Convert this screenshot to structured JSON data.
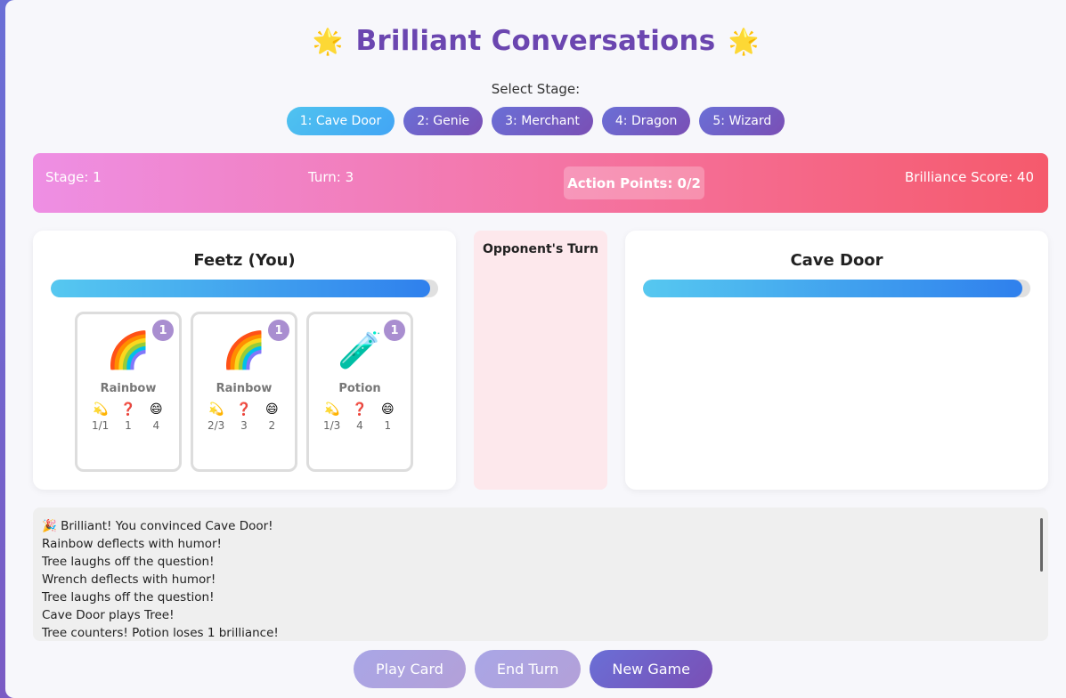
{
  "title": "Brilliant Conversations",
  "title_icon": "star-emoji",
  "stage_select_label": "Select Stage:",
  "stages": [
    {
      "label": "1: Cave Door",
      "active": true
    },
    {
      "label": "2: Genie",
      "active": false
    },
    {
      "label": "3: Merchant",
      "active": false
    },
    {
      "label": "4: Dragon",
      "active": false
    },
    {
      "label": "5: Wizard",
      "active": false
    }
  ],
  "status": {
    "stage": "Stage: 1",
    "turn": "Turn: 3",
    "action_points": "Action Points: 0/2",
    "score": "Brilliance Score: 40"
  },
  "player": {
    "name": "Feetz (You)",
    "brilliance_fraction": 0.98,
    "cards": [
      {
        "icon": "🌈",
        "name": "Rainbow",
        "cost": "1",
        "stats": [
          "1/1",
          "1",
          "4"
        ]
      },
      {
        "icon": "🌈",
        "name": "Rainbow",
        "cost": "1",
        "stats": [
          "2/3",
          "3",
          "2"
        ]
      },
      {
        "icon": "🧪",
        "name": "Potion",
        "cost": "1",
        "stats": [
          "1/3",
          "4",
          "1"
        ]
      }
    ]
  },
  "turn_indicator": "Opponent's Turn",
  "opponent": {
    "name": "Cave Door",
    "brilliance_fraction": 0.98
  },
  "stat_icons": [
    "💫",
    "❓",
    "😄"
  ],
  "log": [
    "🎉 Brilliant! You convinced Cave Door!",
    "Rainbow deflects with humor!",
    "Tree laughs off the question!",
    "Wrench deflects with humor!",
    "Tree laughs off the question!",
    "Cave Door plays Tree!",
    "Tree counters! Potion loses 1 brilliance!"
  ],
  "buttons": {
    "play_card": "Play Card",
    "end_turn": "End Turn",
    "new_game": "New Game"
  },
  "colors": {
    "title": "#6b46b0",
    "accent": "#6a6fd6",
    "active_stage": "#4fc3ef",
    "status_start": "#ee8fe4",
    "status_end": "#f55a6c"
  }
}
